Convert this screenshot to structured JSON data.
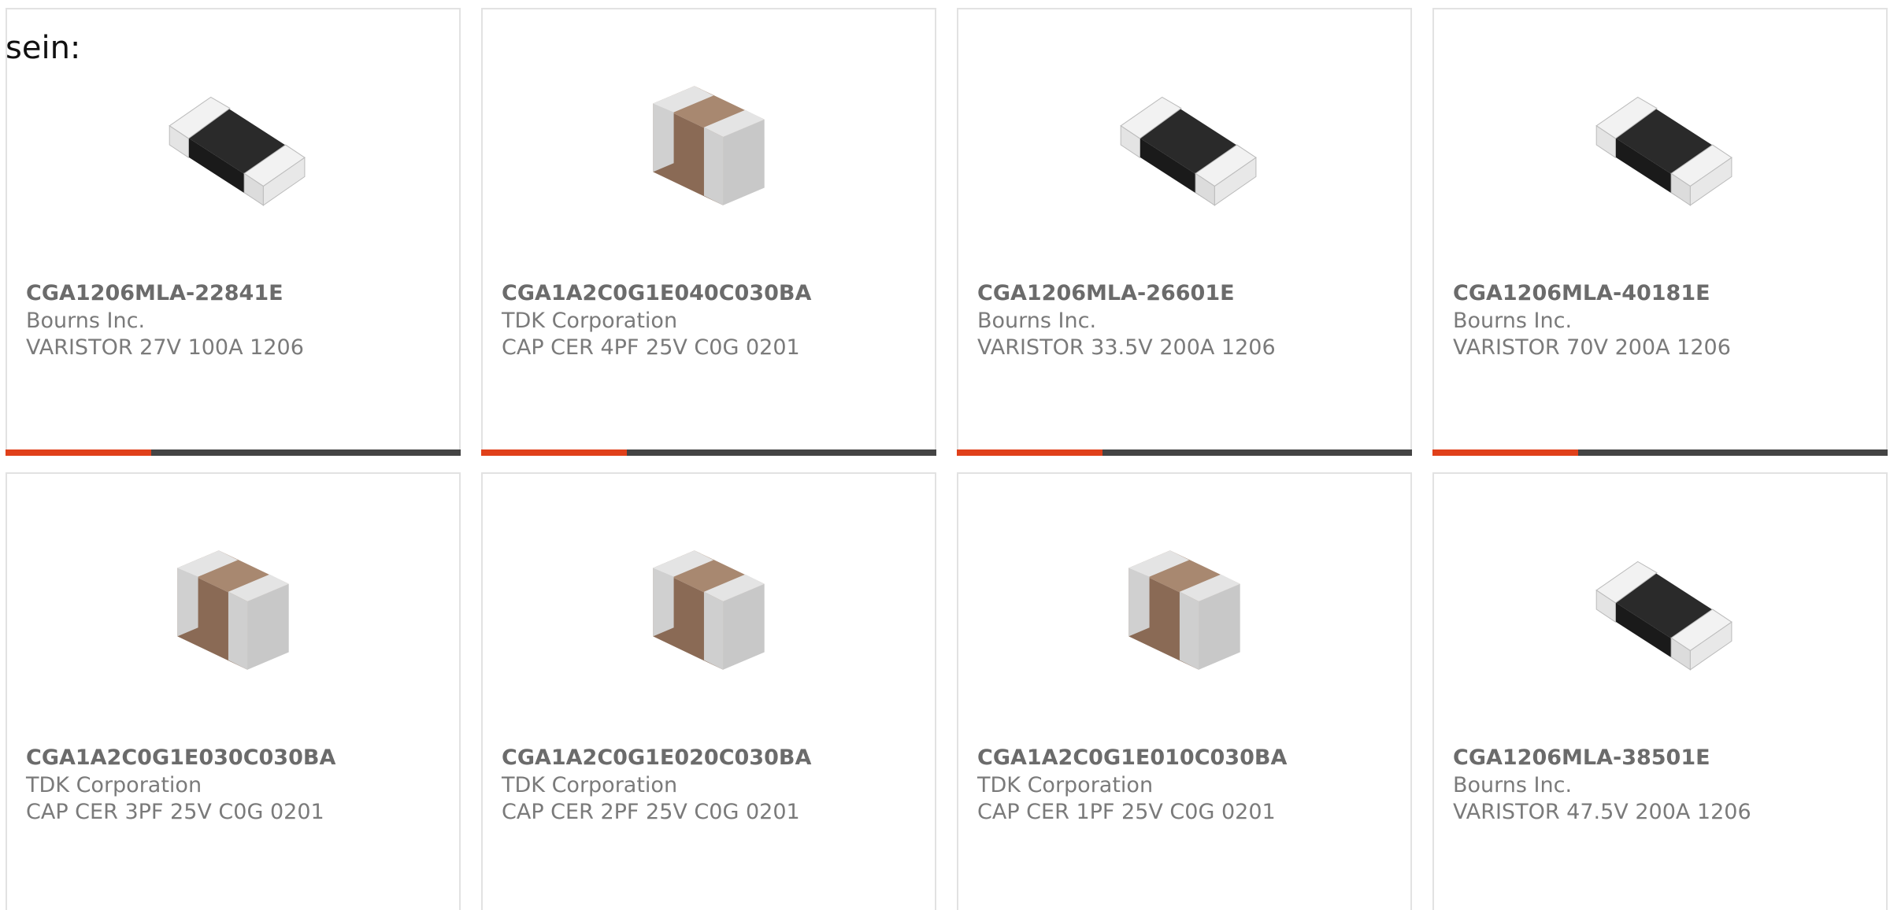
{
  "intro_text": "sein:",
  "accent_color": "#e0401a",
  "products": [
    {
      "part_number": "CGA1206MLA-22841E",
      "manufacturer": "Bourns Inc.",
      "description": "VARISTOR 27V 100A 1206",
      "image": "varistor-chip-icon",
      "progress": 0.32
    },
    {
      "part_number": "CGA1A2C0G1E040C030BA",
      "manufacturer": "TDK Corporation",
      "description": "CAP CER 4PF 25V C0G 0201",
      "image": "ceramic-capacitor-chip-icon",
      "progress": 0.32
    },
    {
      "part_number": "CGA1206MLA-26601E",
      "manufacturer": "Bourns Inc.",
      "description": "VARISTOR 33.5V 200A 1206",
      "image": "varistor-chip-icon",
      "progress": 0.32
    },
    {
      "part_number": "CGA1206MLA-40181E",
      "manufacturer": "Bourns Inc.",
      "description": "VARISTOR 70V 200A 1206",
      "image": "varistor-chip-icon",
      "progress": 0.32
    },
    {
      "part_number": "CGA1A2C0G1E030C030BA",
      "manufacturer": "TDK Corporation",
      "description": "CAP CER 3PF 25V C0G 0201",
      "image": "ceramic-capacitor-chip-icon"
    },
    {
      "part_number": "CGA1A2C0G1E020C030BA",
      "manufacturer": "TDK Corporation",
      "description": "CAP CER 2PF 25V C0G 0201",
      "image": "ceramic-capacitor-chip-icon"
    },
    {
      "part_number": "CGA1A2C0G1E010C030BA",
      "manufacturer": "TDK Corporation",
      "description": "CAP CER 1PF 25V C0G 0201",
      "image": "ceramic-capacitor-chip-icon"
    },
    {
      "part_number": "CGA1206MLA-38501E",
      "manufacturer": "Bourns Inc.",
      "description": "VARISTOR 47.5V 200A 1206",
      "image": "varistor-chip-icon"
    }
  ]
}
